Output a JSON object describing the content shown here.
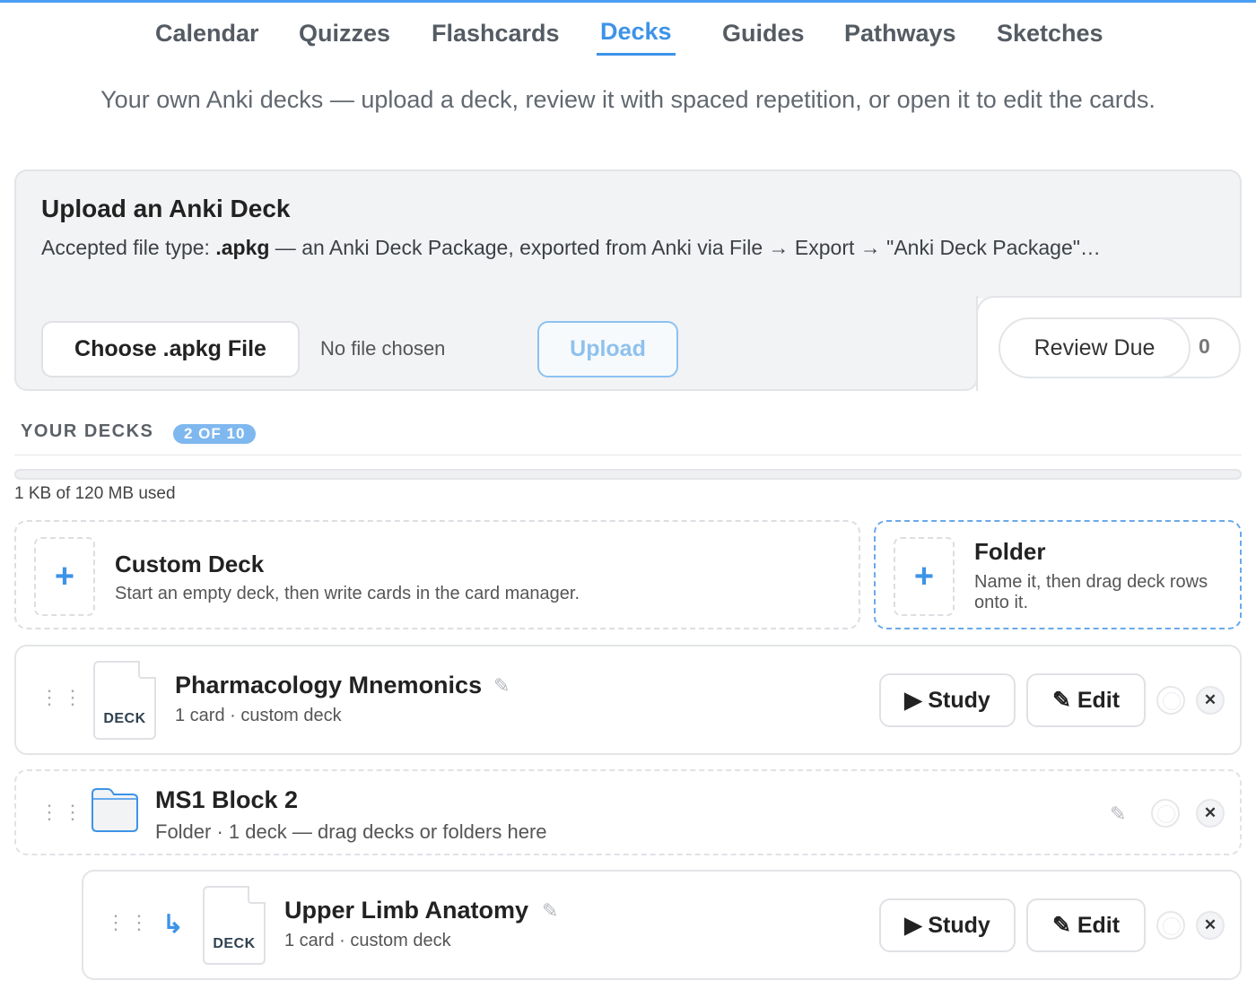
{
  "nav": {
    "tabs": [
      {
        "label": "Calendar"
      },
      {
        "label": "Quizzes"
      },
      {
        "label": "Flashcards"
      },
      {
        "label": "Decks",
        "active": true
      },
      {
        "label": "Guides"
      },
      {
        "label": "Pathways"
      },
      {
        "label": "Sketches"
      }
    ]
  },
  "subtitle": "Your own Anki decks — upload a deck, review it with spaced repetition, or open it to edit the cards.",
  "upload": {
    "title": "Upload an Anki Deck",
    "desc_prefix": "Accepted file type: ",
    "desc_ext": ".apkg",
    "desc_suffix": " — an Anki Deck Package, exported from Anki via File → Export → \"Anki Deck Package\"…",
    "choose_label": "Choose .apkg File",
    "no_file": "No file chosen",
    "upload_label": "Upload"
  },
  "review": {
    "label": "Review Due",
    "count": "0"
  },
  "decks_section": {
    "heading": "YOUR DECKS",
    "badge": "2 OF 10",
    "storage_text": "1 KB of 120 MB used",
    "storage_fraction": 1e-05
  },
  "create": {
    "custom": {
      "icon": "plus-icon",
      "title": "Custom Deck",
      "desc": "Start an empty deck, then write cards in the card manager."
    },
    "folder": {
      "icon": "plus-icon",
      "title": "Folder",
      "desc": "Name it, then drag deck rows onto it."
    }
  },
  "rows": [
    {
      "type": "deck",
      "icon_label": "DECK",
      "title": "Pharmacology Mnemonics",
      "sub": "1 card · custom deck",
      "study_label": "▶ Study",
      "edit_label": "✎ Edit"
    },
    {
      "type": "folder",
      "title": "MS1 Block 2",
      "sub": "Folder · 1 deck — drag decks or folders here"
    },
    {
      "type": "deck",
      "child": true,
      "icon_label": "DECK",
      "title": "Upper Limb Anatomy",
      "sub": "1 card · custom deck",
      "study_label": "▶ Study",
      "edit_label": "✎ Edit"
    }
  ],
  "colors": {
    "accent": "#3d93e8",
    "badge": "#7fb8ef"
  }
}
